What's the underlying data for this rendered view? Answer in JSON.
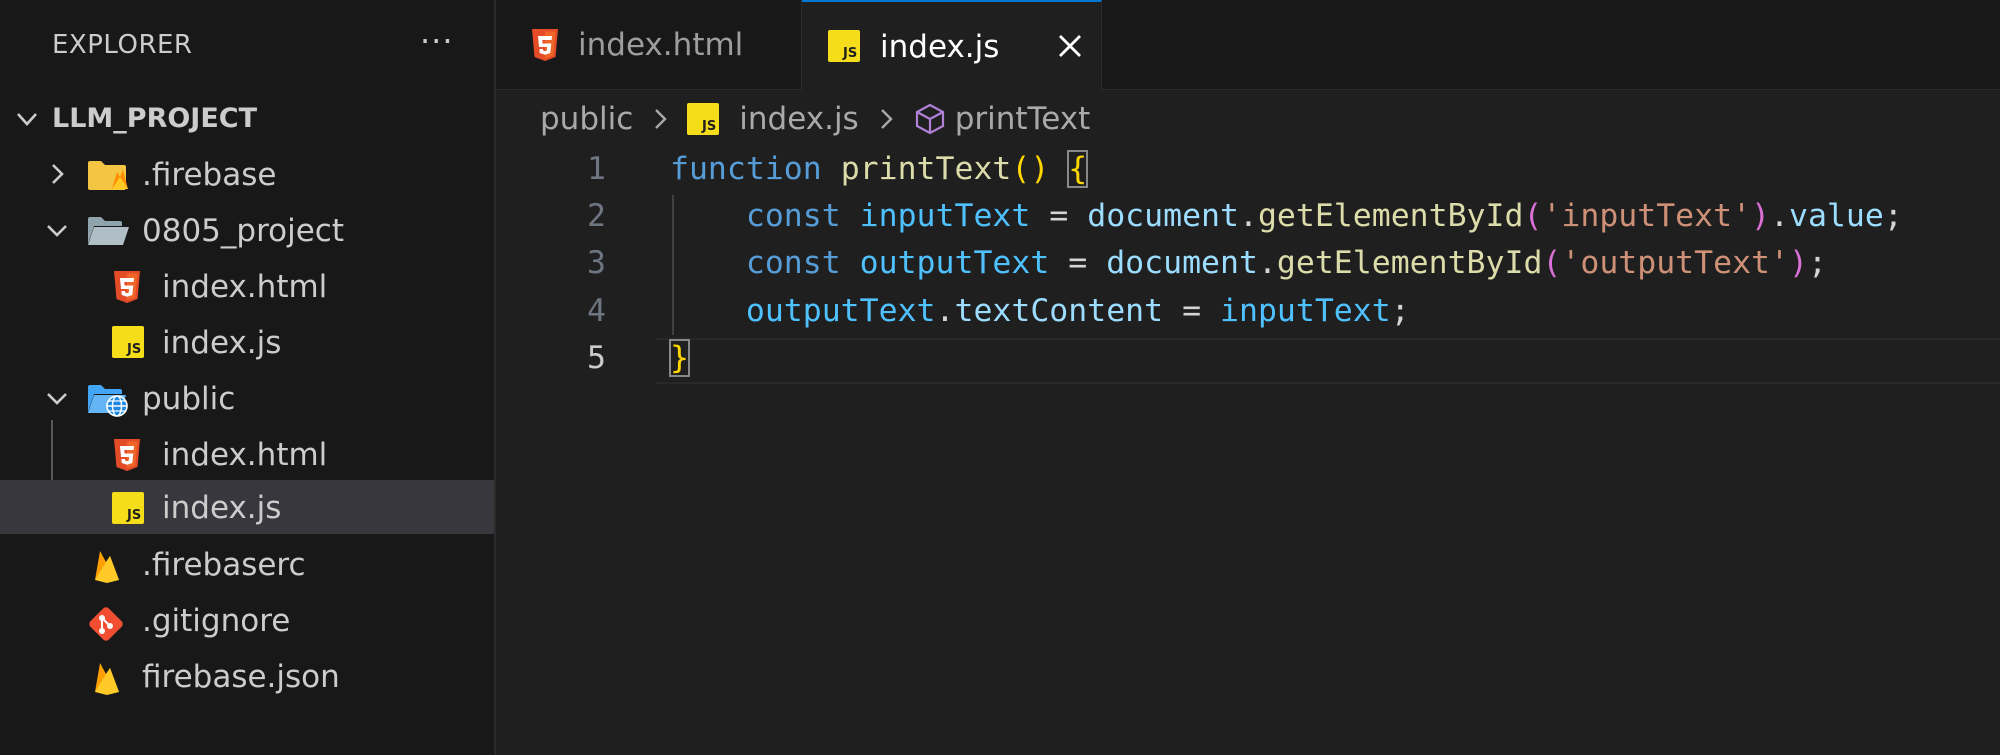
{
  "sidebar": {
    "title": "EXPLORER",
    "more_label": "···",
    "root": {
      "label": "LLM_PROJECT",
      "expanded": true
    },
    "items": [
      {
        "label": ".firebase",
        "kind": "folder",
        "icon": "firebase-folder-icon",
        "expanded": false
      },
      {
        "label": "0805_project",
        "kind": "folder",
        "icon": "folder-open-icon",
        "expanded": true
      },
      {
        "label": "index.html",
        "kind": "file",
        "icon": "html5-icon"
      },
      {
        "label": "index.js",
        "kind": "file",
        "icon": "js-icon"
      },
      {
        "label": "public",
        "kind": "folder",
        "icon": "public-folder-icon",
        "expanded": true
      },
      {
        "label": "index.html",
        "kind": "file",
        "icon": "html5-icon"
      },
      {
        "label": "index.js",
        "kind": "file",
        "icon": "js-icon",
        "selected": true
      },
      {
        "label": ".firebaserc",
        "kind": "file",
        "icon": "firebase-icon"
      },
      {
        "label": ".gitignore",
        "kind": "file",
        "icon": "git-icon"
      },
      {
        "label": "firebase.json",
        "kind": "file",
        "icon": "firebase-icon"
      }
    ]
  },
  "tabs": [
    {
      "label": "index.html",
      "icon": "html5-icon",
      "active": false
    },
    {
      "label": "index.js",
      "icon": "js-icon",
      "active": true,
      "close_label": "✕"
    }
  ],
  "breadcrumb": {
    "folder": "public",
    "file": "index.js",
    "symbol": "printText"
  },
  "editor": {
    "line_numbers": [
      "1",
      "2",
      "3",
      "4",
      "5"
    ],
    "current_line": 5,
    "code": {
      "l1": {
        "kw": "function",
        "fn": "printText",
        "paren": "()",
        "brace": "{"
      },
      "l2": {
        "kw": "const",
        "var": "inputText",
        "eq": " = ",
        "obj": "document",
        "dot1": ".",
        "method": "getElementById",
        "open": "(",
        "str": "'inputText'",
        "close": ")",
        "dot2": ".",
        "prop": "value",
        "semi": ";"
      },
      "l3": {
        "kw": "const",
        "var": "outputText",
        "eq": " = ",
        "obj": "document",
        "dot1": ".",
        "method": "getElementById",
        "open": "(",
        "str": "'outputText'",
        "close": ")",
        "semi": ";"
      },
      "l4": {
        "var": "outputText",
        "dot": ".",
        "prop": "textContent",
        "eq": " = ",
        "var2": "inputText",
        "semi": ";"
      },
      "l5": {
        "brace": "}"
      }
    }
  },
  "colors": {
    "accent": "#0078d4",
    "html5": "#e34c26",
    "js": "#f5de19",
    "firebase": "#ffca28",
    "git": "#f14e32",
    "folder": "#90a4ae"
  }
}
